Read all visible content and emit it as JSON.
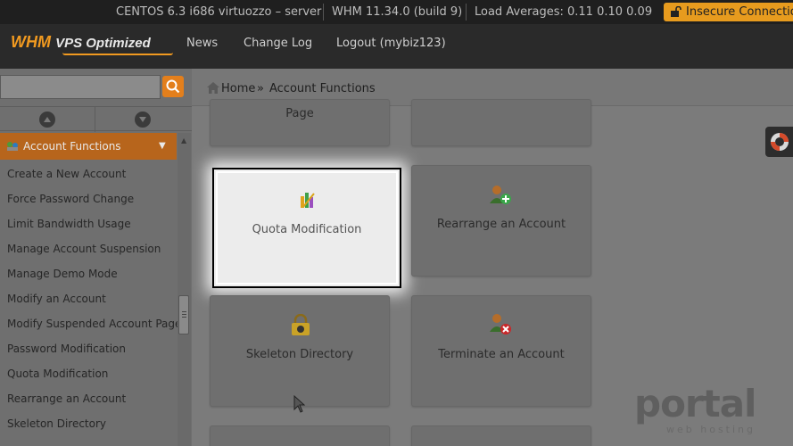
{
  "status_bar": {
    "os": "CENTOS 6.3 i686 virtuozzo – server",
    "version": "WHM 11.34.0 (build 9)",
    "load": "Load Averages: 0.11 0.10 0.09",
    "security": "Insecure Connection",
    "security_color": "#e79b1e"
  },
  "header": {
    "logo_primary": "WHM",
    "logo_secondary": "VPS Optimized",
    "links": [
      "News",
      "Change Log",
      "Logout (mybiz123)"
    ]
  },
  "sidebar": {
    "search_value": "",
    "search_icon": "search-icon",
    "section_title": "Account Functions",
    "items": [
      "Create a New Account",
      "Force Password Change",
      "Limit Bandwidth Usage",
      "Manage Account Suspension",
      "Manage Demo Mode",
      "Modify an Account",
      "Modify Suspended Account Page",
      "Password Modification",
      "Quota Modification",
      "Rearrange an Account",
      "Skeleton Directory"
    ]
  },
  "breadcrumb": {
    "home": "Home",
    "separator": "»",
    "current": "Account Functions"
  },
  "tiles": {
    "page_partial": "Page",
    "quota": "Quota Modification",
    "rearrange": "Rearrange an Account",
    "skeleton": "Skeleton Directory",
    "terminate": "Terminate an Account"
  },
  "watermark": {
    "main": "portal",
    "sub": "web hosting"
  },
  "colors": {
    "accent": "#e37f1c",
    "section_header": "#b7651c"
  }
}
